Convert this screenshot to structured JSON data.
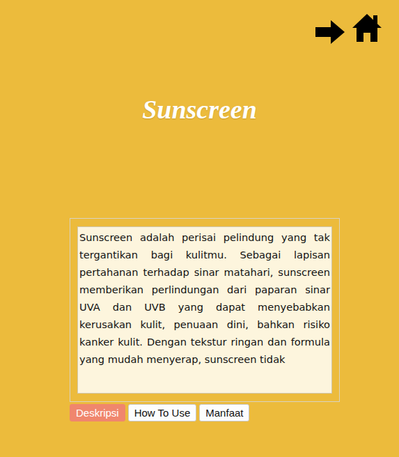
{
  "title": "Sunscreen",
  "description": "Sunscreen adalah perisai pelindung yang tak tergantikan bagi kulitmu. Sebagai lapisan pertahanan terhadap sinar matahari, sunscreen memberikan perlindungan dari paparan sinar UVA dan UVB yang dapat menyebabkan kerusakan kulit, penuaan dini, bahkan risiko kanker kulit. Dengan tekstur ringan dan formula yang mudah menyerap, sunscreen tidak",
  "tabs": [
    {
      "label": "Deskripsi",
      "selected": true
    },
    {
      "label": "How To Use",
      "selected": false
    },
    {
      "label": "Manfaat",
      "selected": false
    }
  ]
}
